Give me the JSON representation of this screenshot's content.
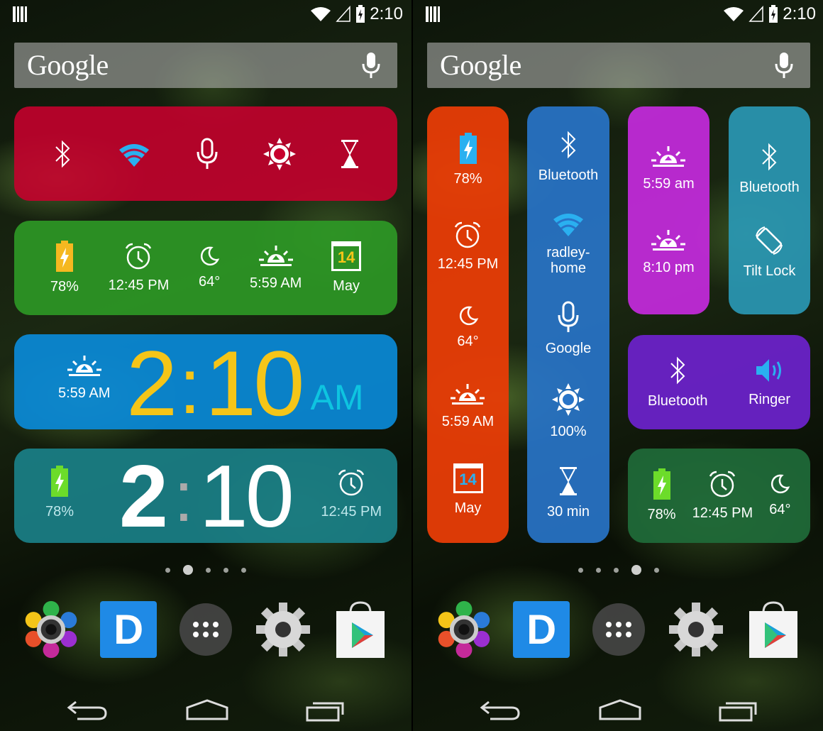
{
  "status": {
    "time": "2:10"
  },
  "search": {
    "brand": "Google"
  },
  "left": {
    "toggles": [
      "bluetooth-icon",
      "wifi-icon",
      "mic-icon",
      "brightness-icon",
      "timer-icon"
    ],
    "info": [
      {
        "icon": "battery-icon",
        "label": "78%"
      },
      {
        "icon": "alarm-icon",
        "label": "12:45 PM"
      },
      {
        "icon": "moon-icon",
        "label": "64°"
      },
      {
        "icon": "sunrise-icon",
        "label": "5:59 AM"
      },
      {
        "icon": "calendar-icon",
        "label": "May",
        "day": "14"
      }
    ],
    "clock1": {
      "sunrise": "5:59 AM",
      "hour": "2",
      "min": "10",
      "ampm": "AM"
    },
    "clock2": {
      "battery": "78%",
      "hour": "2",
      "min": "10",
      "alarm": "12:45 PM"
    }
  },
  "right": {
    "col1": [
      {
        "icon": "battery-icon",
        "label": "78%"
      },
      {
        "icon": "alarm-icon",
        "label": "12:45 PM"
      },
      {
        "icon": "moon-icon",
        "label": "64°"
      },
      {
        "icon": "sunrise-icon",
        "label": "5:59 AM"
      },
      {
        "icon": "calendar-icon",
        "label": "May",
        "day": "14"
      }
    ],
    "col2": [
      {
        "icon": "bluetooth-icon",
        "label": "Bluetooth"
      },
      {
        "icon": "wifi-icon",
        "label": "radley-\nhome"
      },
      {
        "icon": "mic-icon",
        "label": "Google"
      },
      {
        "icon": "brightness-icon",
        "label": "100%"
      },
      {
        "icon": "timer-icon",
        "label": "30 min"
      }
    ],
    "magenta": [
      {
        "icon": "sunrise-icon",
        "label": "5:59 am"
      },
      {
        "icon": "sunset-icon",
        "label": "8:10 pm"
      }
    ],
    "teal": [
      {
        "icon": "bluetooth-icon",
        "label": "Bluetooth"
      },
      {
        "icon": "rotate-icon",
        "label": "Tilt Lock"
      }
    ],
    "purple": [
      {
        "icon": "bluetooth-icon",
        "label": "Bluetooth"
      },
      {
        "icon": "speaker-icon",
        "label": "Ringer"
      }
    ],
    "green": [
      {
        "icon": "battery-icon",
        "label": "78%"
      },
      {
        "icon": "alarm-icon",
        "label": "12:45 PM"
      },
      {
        "icon": "moon-icon",
        "label": "64°"
      }
    ]
  },
  "colors": {
    "red": "#b8002c",
    "green": "#2e9a26",
    "blue": "#0a8ad8",
    "teal": "#1a8088",
    "orange": "#e83c06",
    "blue2": "#2874c8",
    "magenta": "#c02ad8",
    "teal2": "#2a9ab8",
    "purple": "#6a22c8",
    "green2": "#1f6b3a",
    "clockYellow": "#f5c518"
  }
}
